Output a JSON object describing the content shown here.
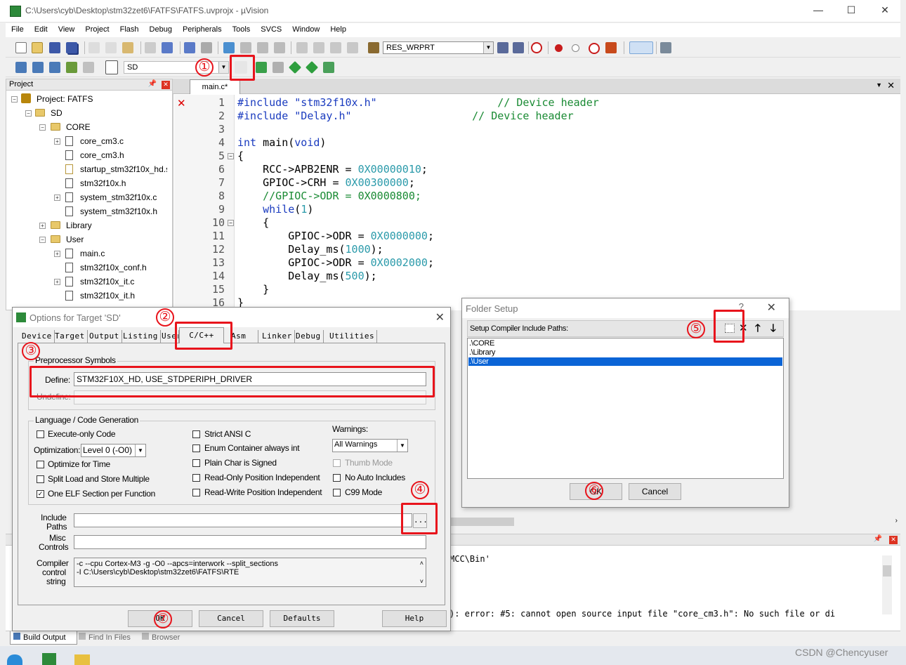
{
  "window": {
    "title": "C:\\Users\\cyb\\Desktop\\stm32zet6\\FATFS\\FATFS.uvprojx - µVision",
    "minimize": "—",
    "maximize": "☐",
    "close": "✕"
  },
  "menu": [
    "File",
    "Edit",
    "View",
    "Project",
    "Flash",
    "Debug",
    "Peripherals",
    "Tools",
    "SVCS",
    "Window",
    "Help"
  ],
  "toolbar": {
    "find_combo": "RES_WRPRT",
    "target_combo": "SD"
  },
  "project": {
    "header": "Project",
    "root": "Project: FATFS",
    "target": "SD",
    "groups": [
      {
        "name": "CORE",
        "files": [
          "core_cm3.c",
          "core_cm3.h",
          "startup_stm32f10x_hd.s",
          "stm32f10x.h",
          "system_stm32f10x.c",
          "system_stm32f10x.h"
        ]
      },
      {
        "name": "Library"
      },
      {
        "name": "User",
        "files": [
          "main.c",
          "stm32f10x_conf.h",
          "stm32f10x_it.c",
          "stm32f10x_it.h"
        ]
      }
    ]
  },
  "editor": {
    "tab": "main.c*",
    "line_numbers": [
      "1",
      "2",
      "3",
      "4",
      "5",
      "6",
      "7",
      "8",
      "9",
      "10",
      "11",
      "12",
      "13",
      "14",
      "15",
      "16"
    ]
  },
  "options_dialog": {
    "title": "Options for Target 'SD'",
    "tabs": [
      "Device",
      "Target",
      "Output",
      "Listing",
      "User",
      "C/C++",
      "Asm",
      "Linker",
      "Debug",
      "Utilities"
    ],
    "preprocessor_group": "Preprocessor Symbols",
    "define_label": "Define:",
    "define_value": "STM32F10X_HD, USE_STDPERIPH_DRIVER",
    "undefine_label": "Undefine:",
    "lang_group": "Language / Code Generation",
    "execute_only": "Execute-only Code",
    "optimization_label": "Optimization:",
    "optimization_value": "Level 0 (-O0)",
    "optimize_time": "Optimize for Time",
    "split_load": "Split Load and Store Multiple",
    "one_elf": "One ELF Section per Function",
    "strict_ansi": "Strict ANSI C",
    "enum_container": "Enum Container always int",
    "plain_char": "Plain Char is Signed",
    "ro_pos": "Read-Only Position Independent",
    "rw_pos": "Read-Write Position Independent",
    "warnings_label": "Warnings:",
    "warnings_value": "All Warnings",
    "thumb_mode": "Thumb Mode",
    "no_auto": "No Auto Includes",
    "c99": "C99 Mode",
    "include_label_1": "Include",
    "include_label_2": "Paths",
    "misc_label_1": "Misc",
    "misc_label_2": "Controls",
    "compiler_label_1": "Compiler",
    "compiler_label_2": "control",
    "compiler_label_3": "string",
    "compiler_line_1": "-c --cpu Cortex-M3 -g -O0 --apcs=interwork --split_sections",
    "compiler_line_2": "-I C:\\Users\\cyb\\Desktop\\stm32zet6\\FATFS\\RTE",
    "browse": "...",
    "ok": "OK",
    "cancel": "Cancel",
    "defaults": "Defaults",
    "help": "Help"
  },
  "folder_dialog": {
    "title": "Folder Setup",
    "help": "?",
    "label": "Setup Compiler Include Paths:",
    "paths": [
      ".\\CORE",
      ".\\Library",
      ".\\User"
    ],
    "ok": "OK",
    "cancel": "Cancel"
  },
  "build_output": {
    "tabs": [
      "Build Output",
      "Find In Files",
      "Browser"
    ],
    "line_1": "MCC\\Bin'",
    "line_2": "): error:  #5: cannot open source input file \"core_cm3.h\": No such file or di"
  },
  "annotations": [
    "①",
    "②",
    "③",
    "④",
    "⑤",
    "⑥",
    "⑦"
  ],
  "watermark": "CSDN @Chencyuser"
}
